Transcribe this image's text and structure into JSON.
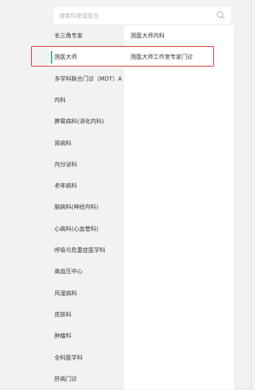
{
  "search": {
    "placeholder": "搜索科室或医生",
    "icon": "search-icon"
  },
  "departments": [
    {
      "label": "长三角专家",
      "active": false
    },
    {
      "label": "国医大师",
      "active": true
    },
    {
      "label": "多学科联合门诊（MDT）A",
      "active": false
    },
    {
      "label": "内科",
      "active": false
    },
    {
      "label": "脾胃病科(消化内科)",
      "active": false
    },
    {
      "label": "肾病科",
      "active": false
    },
    {
      "label": "内分泌科",
      "active": false
    },
    {
      "label": "老年病科",
      "active": false
    },
    {
      "label": "脑病科(神经内科)",
      "active": false
    },
    {
      "label": "心病科(心血管科)",
      "active": false
    },
    {
      "label": "呼吸与危重症医学科",
      "active": false
    },
    {
      "label": "高血压中心",
      "active": false
    },
    {
      "label": "风湿病科",
      "active": false
    },
    {
      "label": "皮肤科",
      "active": false
    },
    {
      "label": "肿瘤科",
      "active": false
    },
    {
      "label": "全科医学科",
      "active": false
    },
    {
      "label": "肝病门诊",
      "active": false
    }
  ],
  "sub_departments": [
    {
      "label": "国医大师内科"
    },
    {
      "label": "国医大师工作室专家门诊"
    }
  ],
  "colors": {
    "active_bar": "#2fbf71",
    "highlight": "#e0241f",
    "background": "#f2f2f2"
  }
}
